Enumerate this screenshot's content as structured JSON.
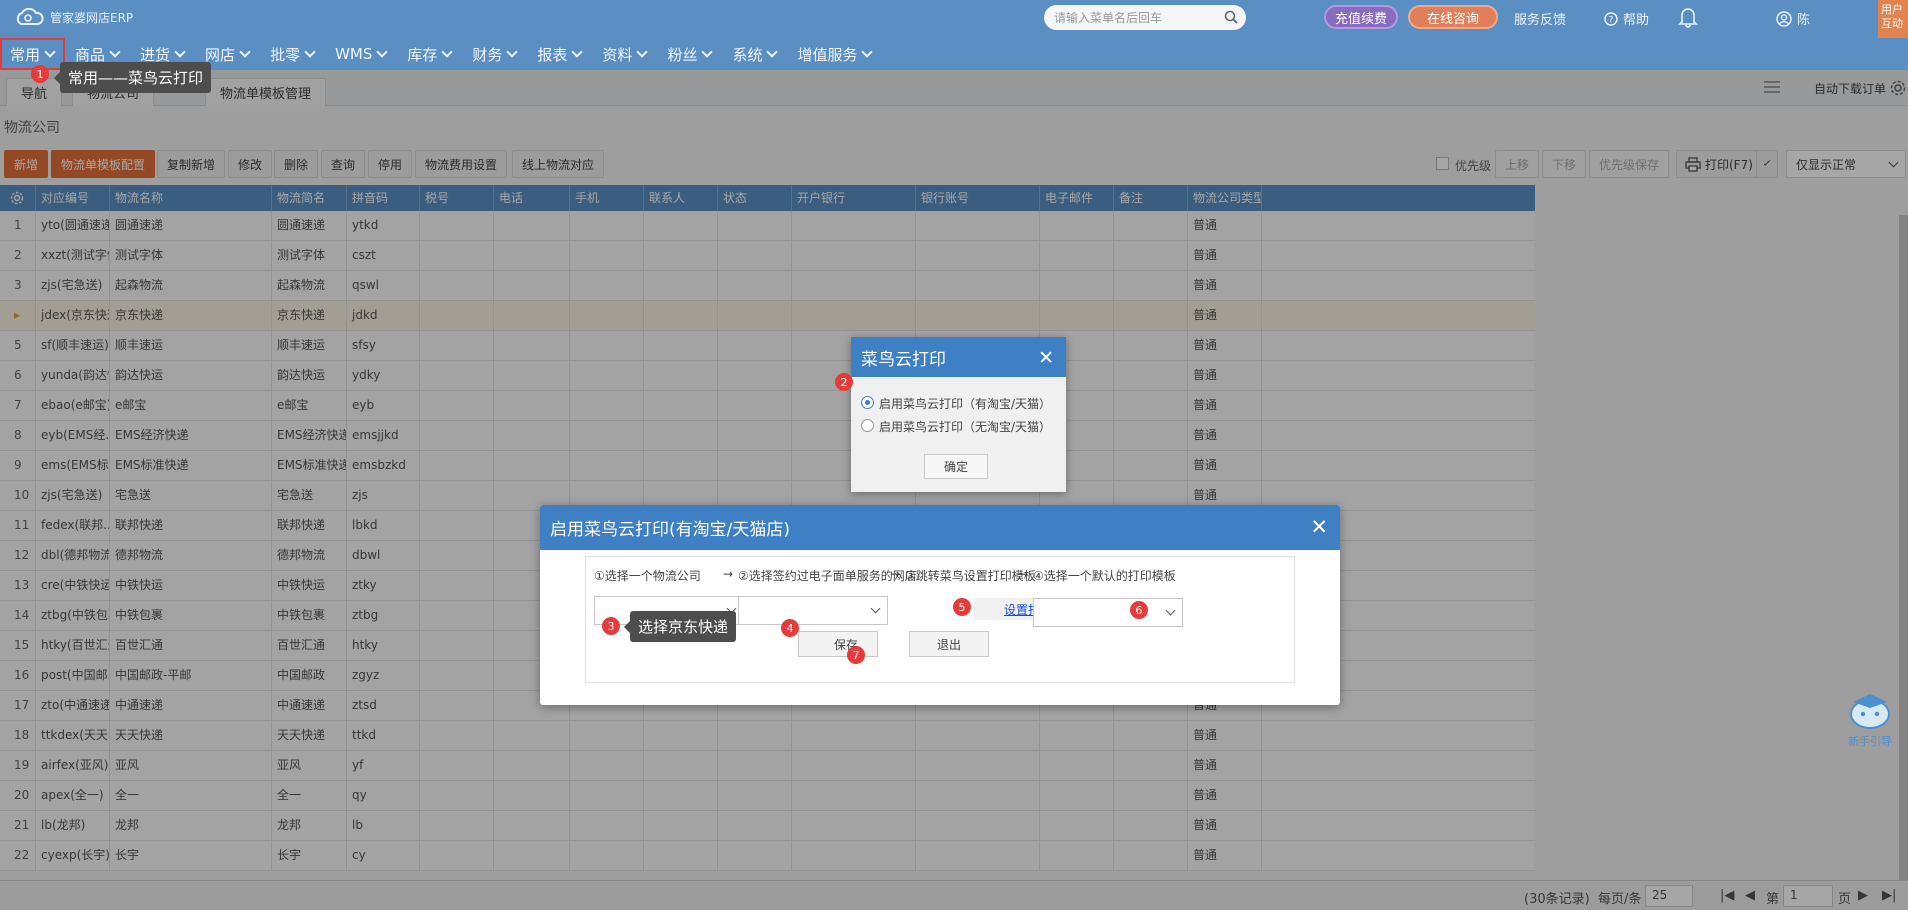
{
  "app": {
    "logo_text": "管家婆网店ERP"
  },
  "header": {
    "search_placeholder": "请输入菜单名后回车",
    "recharge_label": "充值续费",
    "consult_label": "在线咨询",
    "feedback_label": "服务反馈",
    "help_label": "帮助",
    "user_label": "陈",
    "corner_label": "用户互动"
  },
  "menu": [
    "常用",
    "商品",
    "进货",
    "网店",
    "批零",
    "WMS",
    "库存",
    "财务",
    "报表",
    "资料",
    "粉丝",
    "系统",
    "增值服务"
  ],
  "tabs": {
    "nav_label": "导航",
    "hidden_label": "物流公司",
    "template_label": "物流单模板管理",
    "auto_download_label": "自动下载订单"
  },
  "page_title": "物流公司",
  "toolbar": {
    "add": "新增",
    "template_config": "物流单模板配置",
    "copy_add": "复制新增",
    "edit": "修改",
    "delete": "删除",
    "query": "查询",
    "disable": "停用",
    "fee_setting": "物流费用设置",
    "online_mapping": "线上物流对应",
    "priority": "优先级",
    "up": "上移",
    "down": "下移",
    "priority_save": "优先级保存",
    "print": "打印(F7)",
    "filter": "仅显示正常"
  },
  "grid": {
    "columns": [
      "对应编号",
      "物流名称",
      "物流简名",
      "拼音码",
      "税号",
      "电话",
      "手机",
      "联系人",
      "状态",
      "开户银行",
      "银行账号",
      "电子邮件",
      "备注",
      "物流公司类型"
    ],
    "rows": [
      [
        "1",
        "yto(圆通速递)",
        "圆通速递",
        "圆通速递",
        "ytkd",
        "普通"
      ],
      [
        "2",
        "xxzt(测试字体)",
        "测试字体",
        "测试字体",
        "cszt",
        "普通"
      ],
      [
        "3",
        "zjs(宅急送)",
        "起森物流",
        "起森物流",
        "qswl",
        "普通"
      ],
      [
        "▸",
        "jdex(京东快递)",
        "京东快递",
        "京东快递",
        "jdkd",
        "普通"
      ],
      [
        "5",
        "sf(顺丰速运)",
        "顺丰速运",
        "顺丰速运",
        "sfsy",
        "普通"
      ],
      [
        "6",
        "yunda(韵达快...",
        "韵达快运",
        "韵达快运",
        "ydky",
        "普通"
      ],
      [
        "7",
        "ebao(e邮宝)",
        "e邮宝",
        "e邮宝",
        "eyb",
        "普通"
      ],
      [
        "8",
        "eyb(EMS经...",
        "EMS经济快递",
        "EMS经济快递",
        "emsjjkd",
        "普通"
      ],
      [
        "9",
        "ems(EMS标...",
        "EMS标准快递",
        "EMS标准快递",
        "emsbzkd",
        "普通"
      ],
      [
        "10",
        "zjs(宅急送)",
        "宅急送",
        "宅急送",
        "zjs",
        "普通"
      ],
      [
        "11",
        "fedex(联邦...",
        "联邦快递",
        "联邦快递",
        "lbkd",
        "普通"
      ],
      [
        "12",
        "dbl(德邦物流)",
        "德邦物流",
        "德邦物流",
        "dbwl",
        "普通"
      ],
      [
        "13",
        "cre(中铁快运)",
        "中铁快运",
        "中铁快运",
        "ztky",
        "普通"
      ],
      [
        "14",
        "ztbg(中铁包裹)",
        "中铁包裹",
        "中铁包裹",
        "ztbg",
        "普通"
      ],
      [
        "15",
        "htky(百世汇通)",
        "百世汇通",
        "百世汇通",
        "htky",
        "普通"
      ],
      [
        "16",
        "post(中国邮...",
        "中国邮政-平邮",
        "中国邮政",
        "zgyz",
        "普通"
      ],
      [
        "17",
        "zto(中通速递)",
        "中通速递",
        "中通速递",
        "ztsd",
        "普通"
      ],
      [
        "18",
        "ttkdex(天天...",
        "天天快递",
        "天天快递",
        "ttkd",
        "普通"
      ],
      [
        "19",
        "airfex(亚风)",
        "亚风",
        "亚风",
        "yf",
        "普通"
      ],
      [
        "20",
        "apex(全一)",
        "全一",
        "全一",
        "qy",
        "普通"
      ],
      [
        "21",
        "lb(龙邦)",
        "龙邦",
        "龙邦",
        "lb",
        "普通"
      ],
      [
        "22",
        "cyexp(长宇)",
        "长宇",
        "长宇",
        "cy",
        "普通"
      ]
    ]
  },
  "footer": {
    "records": "(30条记录)",
    "per_page_label": "每页/条",
    "per_page": "25",
    "page_prefix": "第",
    "page": "1",
    "page_suffix": "页"
  },
  "helper_label": "新手引导",
  "cainiao_dialog": {
    "title": "菜鸟云打印",
    "option1": "启用菜鸟云打印（有淘宝/天猫）",
    "option2": "启用菜鸟云打印（无淘宝/天猫）",
    "ok": "确定"
  },
  "enable_dialog": {
    "title": "启用菜鸟云打印(有淘宝/天猫店)",
    "step1": "①选择一个物流公司",
    "step2": "②选择签约过电子面单服务的网店",
    "step3": "③跳转菜鸟设置打印模板",
    "step4": "④选择一个默认的打印模板",
    "arrow": "→",
    "link": "设置打印模板",
    "save": "保存",
    "exit": "退出"
  },
  "annotations": {
    "tooltip1": "常用——菜鸟云打印",
    "tooltip3": "选择京东快递",
    "m1": "1",
    "m2": "2",
    "m3": "3",
    "m4": "4",
    "m5": "5",
    "m6": "6",
    "m7": "7"
  }
}
